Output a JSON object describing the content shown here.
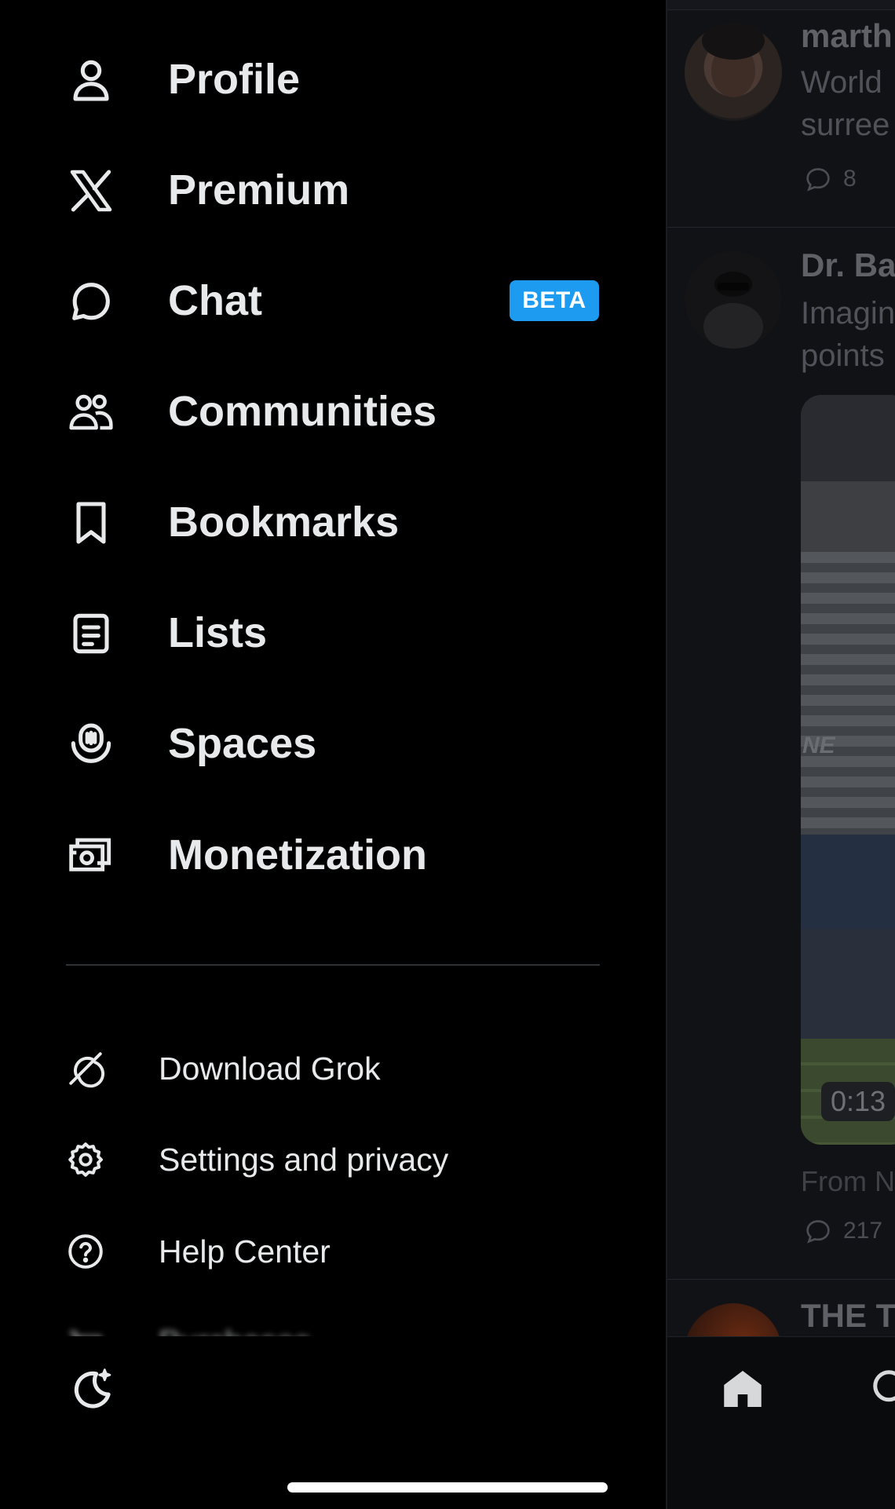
{
  "drawer": {
    "nav_items": [
      {
        "label": "Profile",
        "icon": "person-icon"
      },
      {
        "label": "Premium",
        "icon": "x-logo-icon"
      },
      {
        "label": "Chat",
        "icon": "chat-bubble-icon",
        "badge": "BETA"
      },
      {
        "label": "Communities",
        "icon": "communities-icon"
      },
      {
        "label": "Bookmarks",
        "icon": "bookmark-icon"
      },
      {
        "label": "Lists",
        "icon": "list-icon"
      },
      {
        "label": "Spaces",
        "icon": "spaces-icon"
      },
      {
        "label": "Monetization",
        "icon": "money-icon"
      }
    ],
    "sub_items": [
      {
        "label": "Download Grok",
        "icon": "grok-icon"
      },
      {
        "label": "Settings and privacy",
        "icon": "gear-icon"
      },
      {
        "label": "Help Center",
        "icon": "help-icon"
      }
    ],
    "partial_item": {
      "label": "Purchases",
      "icon": "cart-icon"
    },
    "theme_icon": "moon-sparkle-icon"
  },
  "feed": {
    "posts": [
      {
        "handle": "marth",
        "lines": [
          "World",
          "surree"
        ],
        "replies": "8"
      },
      {
        "handle": "Dr. Ba",
        "lines": [
          "Imagin",
          "points"
        ],
        "video_duration": "0:13",
        "video_overlay_text": "NE",
        "source": "From N",
        "replies": "217"
      },
      {
        "handle": "THE T"
      }
    ]
  },
  "colors": {
    "accent": "#1d9bf0",
    "background": "#000000",
    "text": "#e7e9ea"
  }
}
